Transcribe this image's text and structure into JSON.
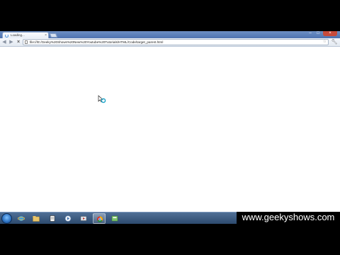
{
  "browser": {
    "tab": {
      "title": "Loading..."
    },
    "address": {
      "url": "file:///E:/Geeky%20Shows%20New%20Youtube%20Tutorials/HTML/Code/target_parent.html"
    }
  },
  "watermark": {
    "text": "www.geekyshows.com"
  },
  "taskbar": {
    "items": [
      {
        "icon": "ie-icon"
      },
      {
        "icon": "explorer-folder-icon"
      },
      {
        "icon": "notepad-icon"
      },
      {
        "icon": "media-player-icon"
      },
      {
        "icon": "video-icon"
      },
      {
        "icon": "chrome-icon"
      },
      {
        "icon": "app-icon"
      }
    ]
  },
  "colors": {
    "titlebar": "#5b7fb9",
    "taskbar": "#3c5b82",
    "close_button": "#c74b3c"
  }
}
